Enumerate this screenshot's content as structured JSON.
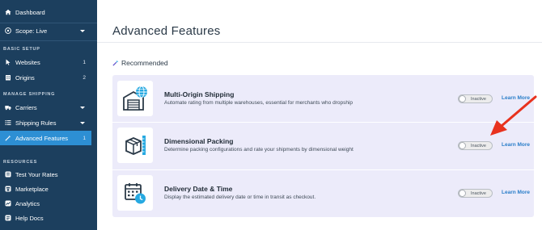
{
  "sidebar": {
    "dashboard": "Dashboard",
    "scope": "Scope: Live",
    "basic_setup": "BASIC SETUP",
    "websites": {
      "label": "Websites",
      "count": "1"
    },
    "origins": {
      "label": "Origins",
      "count": "2"
    },
    "manage_shipping": "MANAGE SHIPPING",
    "carriers": "Carriers",
    "shipping_rules": "Shipping Rules",
    "advanced_features": {
      "label": "Advanced Features",
      "count": "1"
    },
    "resources": "RESOURCES",
    "test_rates": "Test Your Rates",
    "marketplace": "Marketplace",
    "analytics": "Analytics",
    "help_docs": "Help Docs"
  },
  "main": {
    "title": "Advanced Features",
    "recommended": "Recommended",
    "features": [
      {
        "title": "Multi-Origin Shipping",
        "description": "Automate rating from multiple warehouses, essential for merchants who dropship",
        "status": "Inactive",
        "link": "Learn More",
        "icon": "warehouse-globe-icon"
      },
      {
        "title": "Dimensional Packing",
        "description": "Determine packing configurations and rate your shipments by dimensional weight",
        "status": "Inactive",
        "link": "Learn More",
        "icon": "box-ruler-icon"
      },
      {
        "title": "Delivery Date & Time",
        "description": "Display the estimated delivery date or time in transit as checkout.",
        "status": "Inactive",
        "link": "Learn More",
        "icon": "calendar-clock-icon"
      }
    ]
  },
  "colors": {
    "sidebar_bg": "#1c3f5e",
    "active_item": "#2d8fd4",
    "panel_bg": "#ecebfa",
    "link": "#2a7ec9",
    "accent_icon": "#27a9e1",
    "arrow": "#e8321e"
  }
}
